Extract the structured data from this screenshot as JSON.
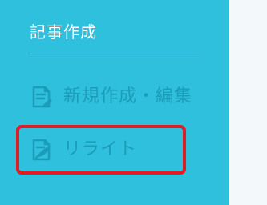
{
  "sidebar": {
    "section_title": "記事作成",
    "items": [
      {
        "label": "新規作成・編集",
        "icon": "document-edit-icon"
      },
      {
        "label": "リライト",
        "icon": "rewrite-icon"
      }
    ]
  },
  "colors": {
    "sidebar_background": "#2ec0dc",
    "nav_text": "#1b9db9",
    "title_text": "#ffffff",
    "highlight_border": "#e31b23",
    "content_background": "#f3f9fb"
  }
}
